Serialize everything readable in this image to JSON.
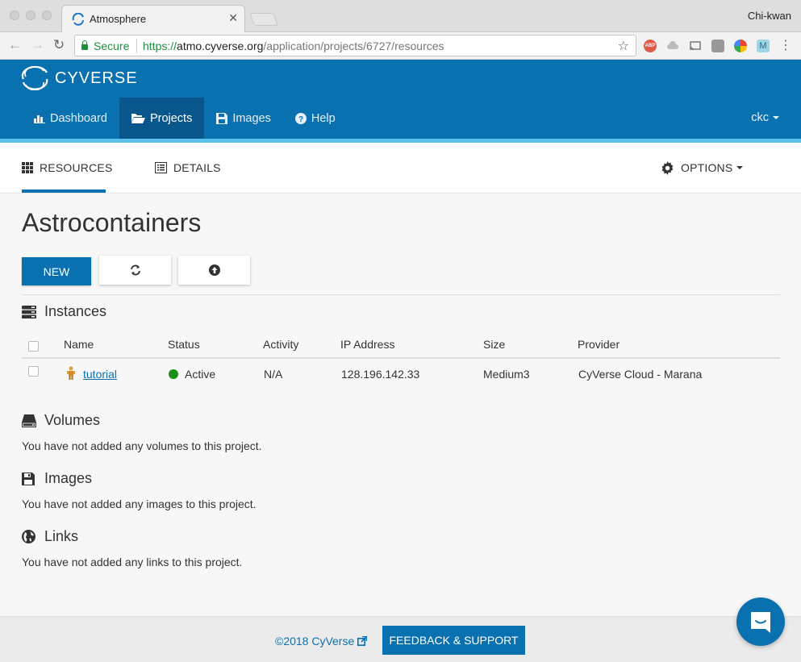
{
  "browser": {
    "tab_title": "Atmosphere",
    "profile_name": "Chi-kwan",
    "secure_label": "Secure",
    "url_scheme": "https://",
    "url_host": "atmo.cyverse.org",
    "url_path": "/application/projects/6727/resources",
    "extensions": [
      "abp-icon",
      "drive-icon",
      "cast-icon",
      "note-icon",
      "chrome-icon",
      "m-icon"
    ]
  },
  "header": {
    "brand": "CYVERSE",
    "nav": [
      {
        "label": "Dashboard",
        "icon": "bar-chart-icon",
        "active": false
      },
      {
        "label": "Projects",
        "icon": "folder-open-icon",
        "active": true
      },
      {
        "label": "Images",
        "icon": "floppy-icon",
        "active": false
      },
      {
        "label": "Help",
        "icon": "question-circle-icon",
        "active": false
      }
    ],
    "user": "ckc"
  },
  "subnav": {
    "resources": "RESOURCES",
    "details": "DETAILS",
    "options": "OPTIONS"
  },
  "project": {
    "title": "Astrocontainers",
    "new_button": "NEW"
  },
  "instances": {
    "heading": "Instances",
    "columns": [
      "Name",
      "Status",
      "Activity",
      "IP Address",
      "Size",
      "Provider"
    ],
    "rows": [
      {
        "name": "tutorial",
        "status": "Active",
        "activity": "N/A",
        "ip": "128.196.142.33",
        "size": "Medium3",
        "provider": "CyVerse Cloud - Marana"
      }
    ]
  },
  "volumes": {
    "heading": "Volumes",
    "empty": "You have not added any volumes to this project."
  },
  "images": {
    "heading": "Images",
    "empty": "You have not added any images to this project."
  },
  "links": {
    "heading": "Links",
    "empty": "You have not added any links to this project."
  },
  "footer": {
    "copyright": "©2018 CyVerse",
    "feedback": "FEEDBACK & SUPPORT"
  },
  "colors": {
    "brand_blue": "#0a71b0",
    "active_nav": "#08568b",
    "accent_strip": "#5bc0eb",
    "status_active": "#1a8f1a"
  }
}
